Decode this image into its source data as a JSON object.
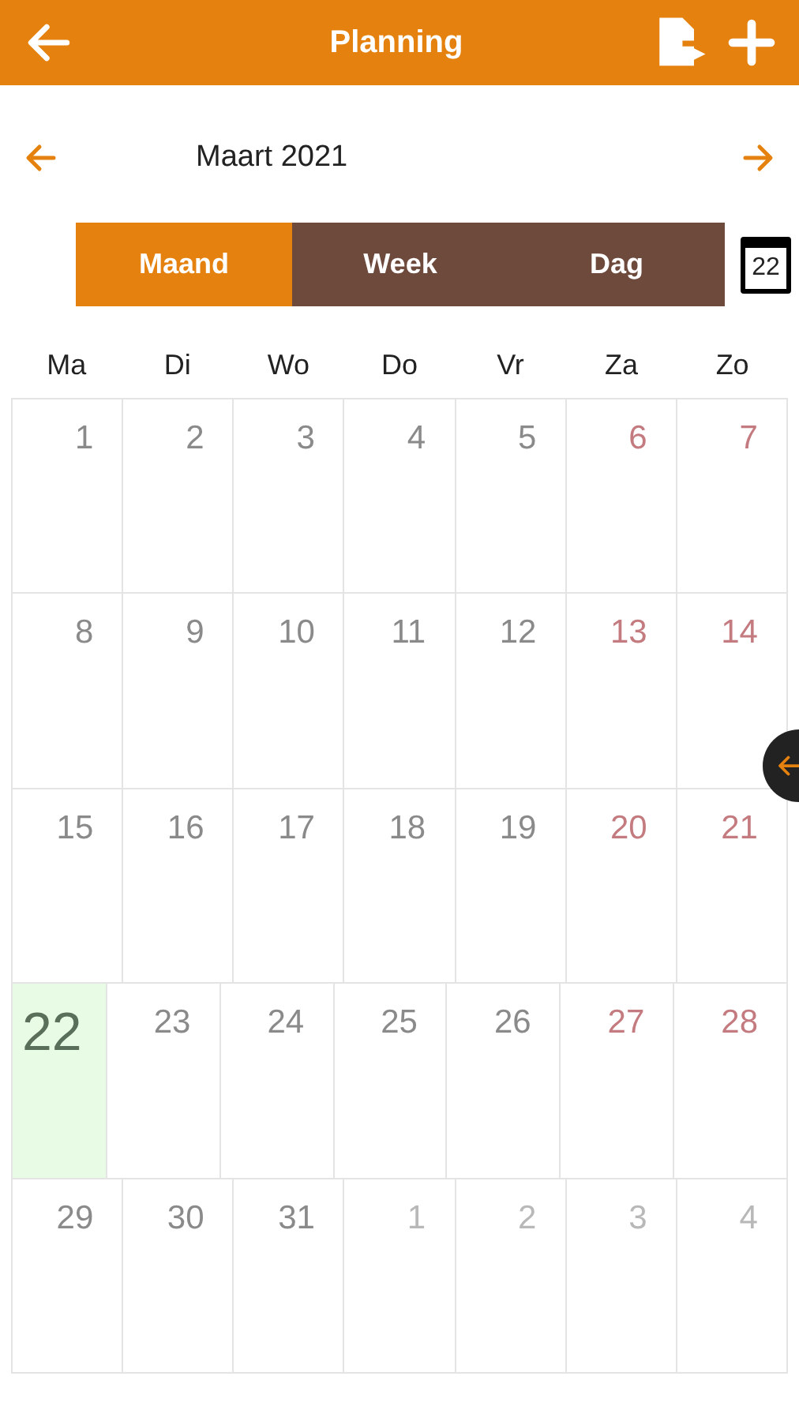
{
  "header": {
    "title": "Planning"
  },
  "month": {
    "label": "Maart 2021"
  },
  "views": [
    {
      "label": "Maand",
      "selected": true
    },
    {
      "label": "Week",
      "selected": false
    },
    {
      "label": "Dag",
      "selected": false
    }
  ],
  "today_button": {
    "day": "22"
  },
  "weekdays": [
    "Ma",
    "Di",
    "Wo",
    "Do",
    "Vr",
    "Za",
    "Zo"
  ],
  "days": [
    {
      "label": "1",
      "kind": "weekday"
    },
    {
      "label": "2",
      "kind": "weekday"
    },
    {
      "label": "3",
      "kind": "weekday"
    },
    {
      "label": "4",
      "kind": "weekday"
    },
    {
      "label": "5",
      "kind": "weekday"
    },
    {
      "label": "6",
      "kind": "weekend"
    },
    {
      "label": "7",
      "kind": "weekend"
    },
    {
      "label": "8",
      "kind": "weekday"
    },
    {
      "label": "9",
      "kind": "weekday"
    },
    {
      "label": "10",
      "kind": "weekday"
    },
    {
      "label": "11",
      "kind": "weekday"
    },
    {
      "label": "12",
      "kind": "weekday"
    },
    {
      "label": "13",
      "kind": "weekend"
    },
    {
      "label": "14",
      "kind": "weekend"
    },
    {
      "label": "15",
      "kind": "weekday"
    },
    {
      "label": "16",
      "kind": "weekday"
    },
    {
      "label": "17",
      "kind": "weekday"
    },
    {
      "label": "18",
      "kind": "weekday"
    },
    {
      "label": "19",
      "kind": "weekday"
    },
    {
      "label": "20",
      "kind": "weekend"
    },
    {
      "label": "21",
      "kind": "weekend"
    },
    {
      "label": "22",
      "kind": "today"
    },
    {
      "label": "23",
      "kind": "weekday"
    },
    {
      "label": "24",
      "kind": "weekday"
    },
    {
      "label": "25",
      "kind": "weekday"
    },
    {
      "label": "26",
      "kind": "weekday"
    },
    {
      "label": "27",
      "kind": "weekend"
    },
    {
      "label": "28",
      "kind": "weekend"
    },
    {
      "label": "29",
      "kind": "weekday"
    },
    {
      "label": "30",
      "kind": "weekday"
    },
    {
      "label": "31",
      "kind": "weekday"
    },
    {
      "label": "1",
      "kind": "other"
    },
    {
      "label": "2",
      "kind": "other"
    },
    {
      "label": "3",
      "kind": "other"
    },
    {
      "label": "4",
      "kind": "other"
    }
  ]
}
